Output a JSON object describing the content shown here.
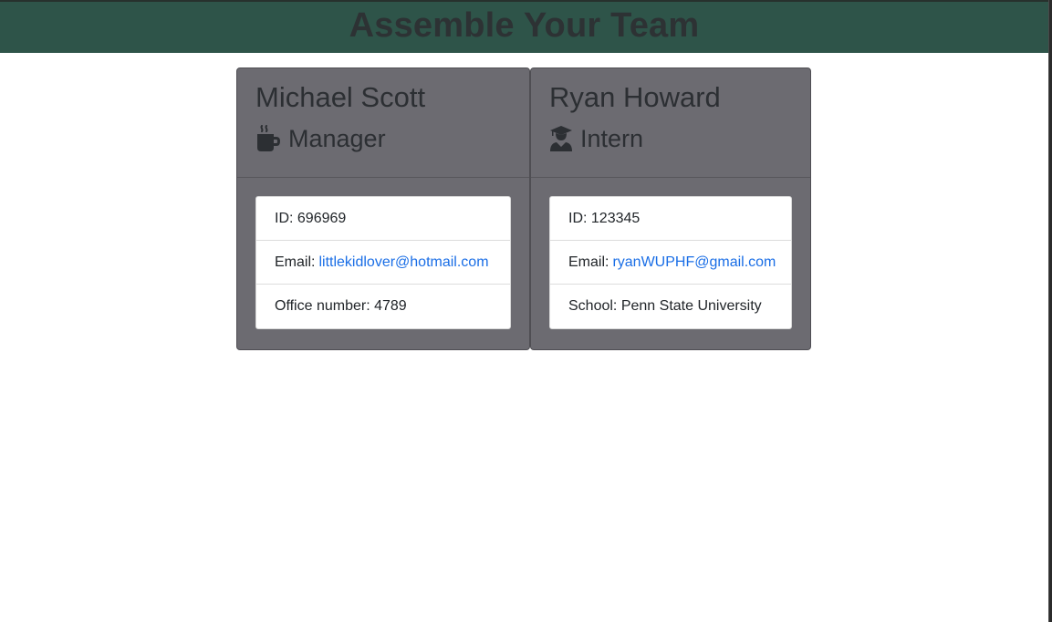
{
  "header": {
    "title": "Assemble Your Team"
  },
  "team": [
    {
      "name": "Michael Scott",
      "role": "Manager",
      "role_icon": "coffee-mug-icon",
      "id_label": "ID:",
      "id_value": "696969",
      "email_label": "Email:",
      "email_value": "littlekidlover@hotmail.com",
      "extra_label": "Office number:",
      "extra_value": "4789"
    },
    {
      "name": "Ryan Howard",
      "role": "Intern",
      "role_icon": "graduate-icon",
      "id_label": "ID:",
      "id_value": "123345",
      "email_label": "Email:",
      "email_value": "ryanWUPHF@gmail.com",
      "extra_label": "School:",
      "extra_value": "Penn State University"
    }
  ],
  "colors": {
    "header_bg": "#2e5449",
    "card_bg": "#6c6b71",
    "link": "#1a6ee6"
  }
}
